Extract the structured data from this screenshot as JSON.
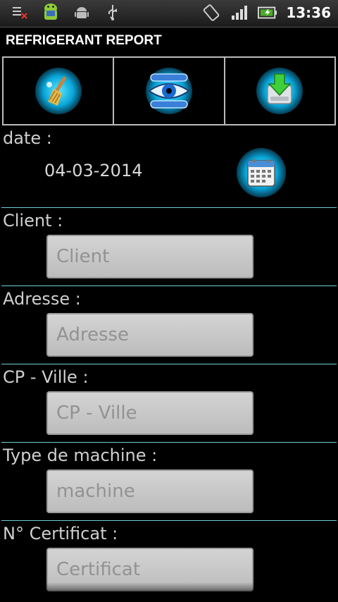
{
  "status": {
    "time": "13:36",
    "icons": [
      "notification-clear-icon",
      "android-robot-icon",
      "android-icon",
      "usb-icon",
      "rotate-icon",
      "signal-icon",
      "battery-icon"
    ]
  },
  "app": {
    "title": "REFRIGERANT REPORT"
  },
  "toolbar": {
    "buttons": [
      {
        "name": "broom-icon"
      },
      {
        "name": "eye-icon"
      },
      {
        "name": "save-download-icon"
      }
    ]
  },
  "form": {
    "date_label": "date :",
    "date_value": "04-03-2014",
    "fields": [
      {
        "label": "Client :",
        "placeholder": "Client"
      },
      {
        "label": "Adresse :",
        "placeholder": "Adresse"
      },
      {
        "label": "CP - Ville :",
        "placeholder": "CP - Ville"
      },
      {
        "label": "Type de machine :",
        "placeholder": "machine"
      },
      {
        "label": "N° Certificat :",
        "placeholder": "Certificat"
      }
    ]
  },
  "colors": {
    "separator": "#6ecfd4",
    "accent": "#09a6d9"
  }
}
